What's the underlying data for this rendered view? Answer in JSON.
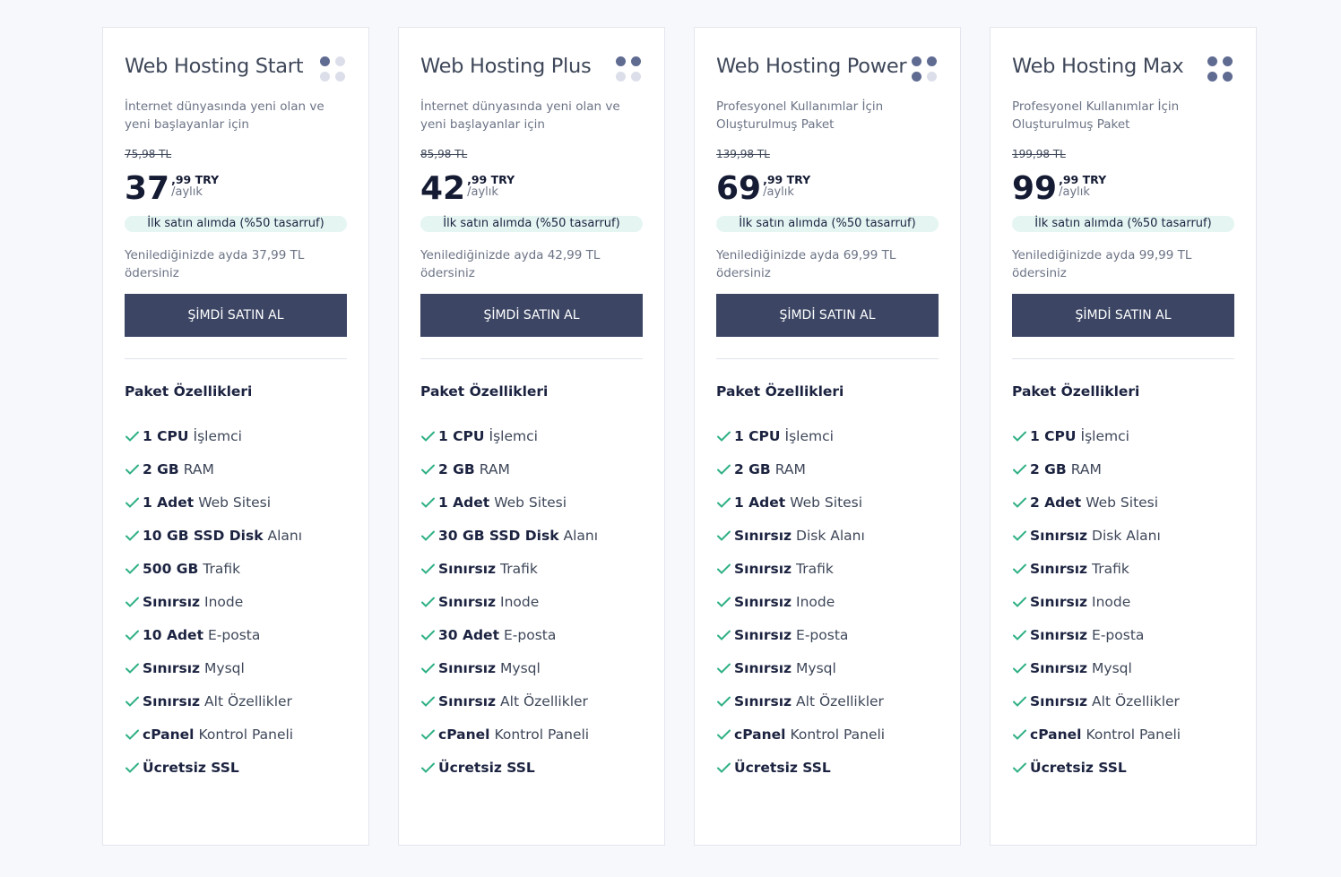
{
  "colors": {
    "accent": "#3c4664",
    "dot_dark": "#5f6b91",
    "dot_light": "#dcdfe9",
    "check": "#2fb084",
    "badge_bg": "#e4f5f2"
  },
  "plans": [
    {
      "title": "Web Hosting Start",
      "dots": [
        "dark",
        "light",
        "light",
        "light"
      ],
      "description": "İnternet dünyasında yeni olan ve yeni başlayanlar için",
      "old_price": "75,98 TL",
      "price_int": "37",
      "price_dec": ",99 TRY",
      "price_period": "/aylık",
      "badge": "İlk satın alımda (%50 tasarruf)",
      "renew": "Yenilediğinizde ayda 37,99 TL ödersiniz",
      "button": "ŞİMDİ SATIN AL",
      "features_title": "Paket Özellikleri",
      "features": [
        {
          "bold": "1 CPU",
          "text": "İşlemci"
        },
        {
          "bold": "2 GB",
          "text": "RAM"
        },
        {
          "bold": "1 Adet",
          "text": "Web Sitesi"
        },
        {
          "bold": "10 GB SSD Disk",
          "text": "Alanı"
        },
        {
          "bold": "500 GB",
          "text": "Trafik"
        },
        {
          "bold": "Sınırsız",
          "text": "Inode"
        },
        {
          "bold": "10 Adet",
          "text": "E-posta"
        },
        {
          "bold": "Sınırsız",
          "text": "Mysql"
        },
        {
          "bold": "Sınırsız",
          "text": "Alt Özellikler"
        },
        {
          "bold": "cPanel",
          "text": "Kontrol Paneli"
        },
        {
          "bold": "Ücretsiz SSL",
          "text": ""
        }
      ]
    },
    {
      "title": "Web Hosting Plus",
      "dots": [
        "dark",
        "dark",
        "light",
        "light"
      ],
      "description": "İnternet dünyasında yeni olan ve yeni başlayanlar için",
      "old_price": "85,98 TL",
      "price_int": "42",
      "price_dec": ",99 TRY",
      "price_period": "/aylık",
      "badge": "İlk satın alımda (%50 tasarruf)",
      "renew": "Yenilediğinizde ayda 42,99 TL ödersiniz",
      "button": "ŞİMDİ SATIN AL",
      "features_title": "Paket Özellikleri",
      "features": [
        {
          "bold": "1 CPU",
          "text": "İşlemci"
        },
        {
          "bold": "2 GB",
          "text": "RAM"
        },
        {
          "bold": "1 Adet",
          "text": "Web Sitesi"
        },
        {
          "bold": "30 GB SSD Disk",
          "text": "Alanı"
        },
        {
          "bold": "Sınırsız",
          "text": "Trafik"
        },
        {
          "bold": "Sınırsız",
          "text": "Inode"
        },
        {
          "bold": "30 Adet",
          "text": "E-posta"
        },
        {
          "bold": "Sınırsız",
          "text": "Mysql"
        },
        {
          "bold": "Sınırsız",
          "text": "Alt Özellikler"
        },
        {
          "bold": "cPanel",
          "text": "Kontrol Paneli"
        },
        {
          "bold": "Ücretsiz SSL",
          "text": ""
        }
      ]
    },
    {
      "title": "Web Hosting Power",
      "dots": [
        "dark",
        "dark",
        "dark",
        "light"
      ],
      "description": "Profesyonel Kullanımlar İçin Oluşturulmuş Paket",
      "old_price": "139,98 TL",
      "price_int": "69",
      "price_dec": ",99 TRY",
      "price_period": "/aylık",
      "badge": "İlk satın alımda (%50 tasarruf)",
      "renew": "Yenilediğinizde ayda 69,99 TL ödersiniz",
      "button": "ŞİMDİ SATIN AL",
      "features_title": "Paket Özellikleri",
      "features": [
        {
          "bold": "1 CPU",
          "text": "İşlemci"
        },
        {
          "bold": "2 GB",
          "text": "RAM"
        },
        {
          "bold": "1 Adet",
          "text": "Web Sitesi"
        },
        {
          "bold": "Sınırsız",
          "text": "Disk Alanı"
        },
        {
          "bold": "Sınırsız",
          "text": "Trafik"
        },
        {
          "bold": "Sınırsız",
          "text": "Inode"
        },
        {
          "bold": "Sınırsız",
          "text": "E-posta"
        },
        {
          "bold": "Sınırsız",
          "text": "Mysql"
        },
        {
          "bold": "Sınırsız",
          "text": "Alt Özellikler"
        },
        {
          "bold": "cPanel",
          "text": "Kontrol Paneli"
        },
        {
          "bold": "Ücretsiz SSL",
          "text": ""
        }
      ]
    },
    {
      "title": "Web Hosting Max",
      "dots": [
        "dark",
        "dark",
        "dark",
        "dark"
      ],
      "description": "Profesyonel Kullanımlar İçin Oluşturulmuş Paket",
      "old_price": "199,98 TL",
      "price_int": "99",
      "price_dec": ",99 TRY",
      "price_period": "/aylık",
      "badge": "İlk satın alımda (%50 tasarruf)",
      "renew": "Yenilediğinizde ayda 99,99 TL ödersiniz",
      "button": "ŞİMDİ SATIN AL",
      "features_title": "Paket Özellikleri",
      "features": [
        {
          "bold": "1 CPU",
          "text": "İşlemci"
        },
        {
          "bold": "2 GB",
          "text": "RAM"
        },
        {
          "bold": "2 Adet",
          "text": "Web Sitesi"
        },
        {
          "bold": "Sınırsız",
          "text": "Disk Alanı"
        },
        {
          "bold": "Sınırsız",
          "text": "Trafik"
        },
        {
          "bold": "Sınırsız",
          "text": "Inode"
        },
        {
          "bold": "Sınırsız",
          "text": "E-posta"
        },
        {
          "bold": "Sınırsız",
          "text": "Mysql"
        },
        {
          "bold": "Sınırsız",
          "text": "Alt Özellikler"
        },
        {
          "bold": "cPanel",
          "text": "Kontrol Paneli"
        },
        {
          "bold": "Ücretsiz SSL",
          "text": ""
        }
      ]
    }
  ]
}
